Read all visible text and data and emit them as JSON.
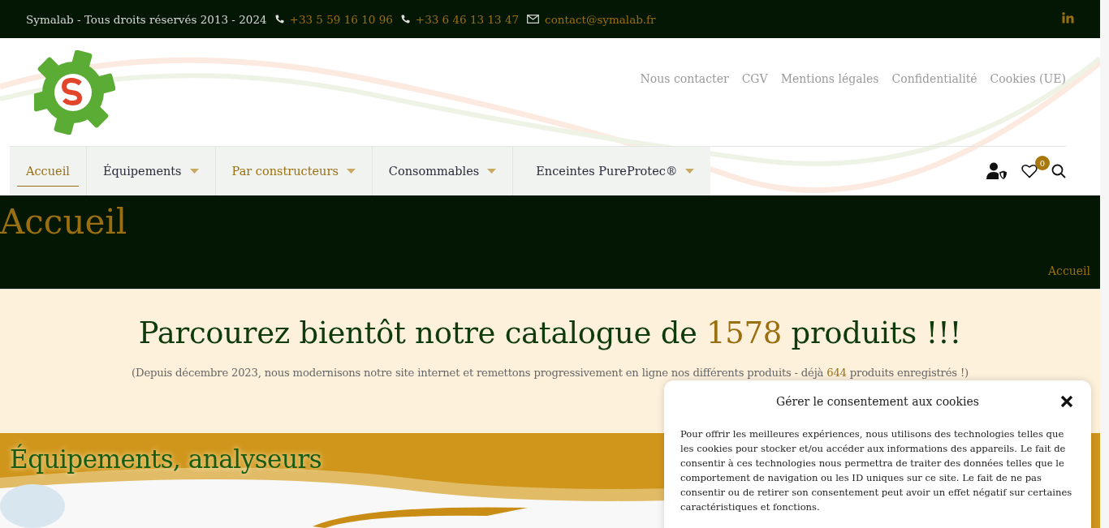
{
  "top_bar": {
    "copyright": "Symalab - Tous droits réservés 2013 - 2024",
    "contacts": [
      {
        "kind": "phone",
        "text": "+33 5 59 16 10 96"
      },
      {
        "kind": "phone",
        "text": "+33 6 46 13 13 47"
      },
      {
        "kind": "email",
        "text": "contact@symalab.fr"
      }
    ]
  },
  "header_links": [
    "Nous contacter",
    "CGV",
    "Mentions légales",
    "Confidentialité",
    "Cookies (UE)"
  ],
  "nav": [
    {
      "label": "Accueil",
      "selected": true,
      "highlighted": false,
      "has_submenu": false
    },
    {
      "label": "Équipements",
      "selected": false,
      "highlighted": false,
      "has_submenu": true
    },
    {
      "label": "Par constructeurs",
      "selected": false,
      "highlighted": true,
      "has_submenu": true
    },
    {
      "label": "Consommables",
      "selected": false,
      "highlighted": false,
      "has_submenu": true
    },
    {
      "label": "Enceintes PureProtec®",
      "selected": false,
      "highlighted": false,
      "has_submenu": true
    }
  ],
  "wishlist_count": "0",
  "page_title": "Accueil",
  "breadcrumb": "Accueil",
  "headline": {
    "before": "Parcourez bientôt notre catalogue de ",
    "count": "1578",
    "after": " produits !!!"
  },
  "subtitle": {
    "before": "(Depuis décembre 2023, nous modernisons notre site internet et remettons progressivement en ligne nos différents produits - déjà ",
    "count": "644",
    "after": " produits enregistrés !)"
  },
  "section_banner": "Équipements, analyseurs",
  "cookie_dialog": {
    "title": "Gérer le consentement aux cookies",
    "body": "Pour offrir les meilleures expériences, nous utilisons des technologies telles que les cookies pour stocker et/ou accéder aux informations des appareils. Le fait de consentir à ces technologies nous permettra de traiter des données telles que le comportement de navigation ou les ID uniques sur ce site. Le fait de ne pas consentir ou de retirer son consentement peut avoir un effet négatif sur certaines caractéristiques et fonctions."
  }
}
